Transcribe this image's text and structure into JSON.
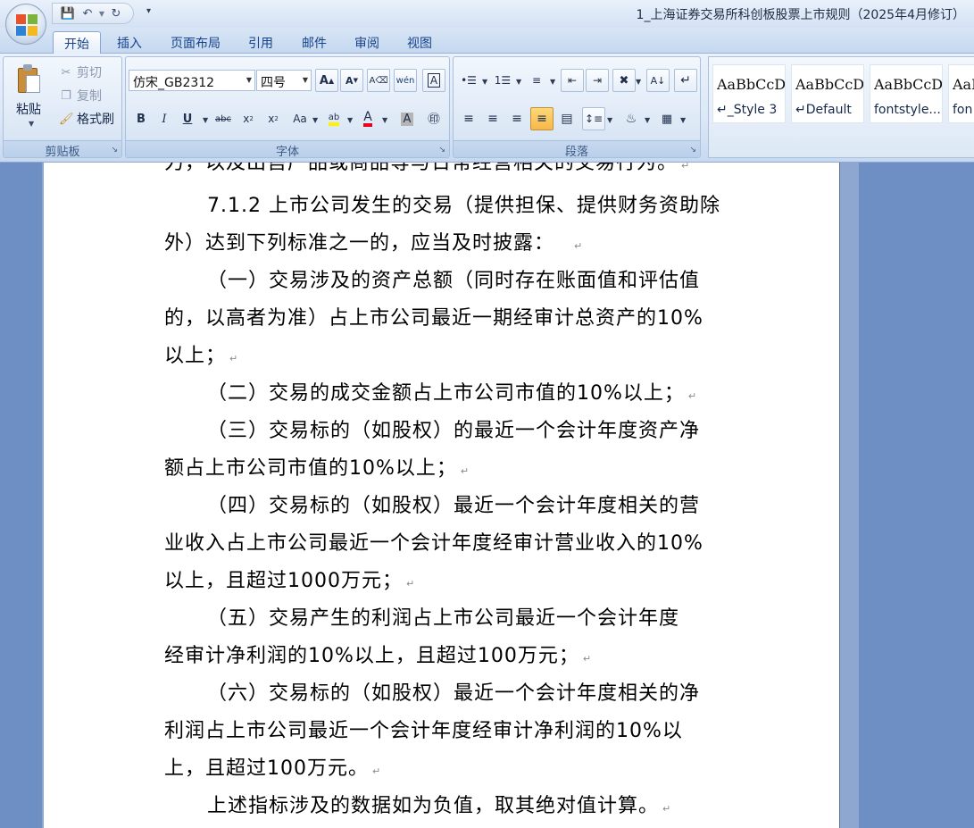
{
  "window": {
    "title": "1_上海证券交易所科创板股票上市规则（2025年4月修订）"
  },
  "tabs": [
    "开始",
    "插入",
    "页面布局",
    "引用",
    "邮件",
    "审阅",
    "视图"
  ],
  "clipboard": {
    "paste": "粘贴",
    "cut": "剪切",
    "copy": "复制",
    "format_painter": "格式刷",
    "group": "剪贴板"
  },
  "font": {
    "name": "仿宋_GB2312",
    "size": "四号",
    "group": "字体"
  },
  "paragraph": {
    "group": "段落"
  },
  "styles": [
    {
      "preview": "AaBbCcD",
      "name": "↵_Style 3"
    },
    {
      "preview": "AaBbCcDc",
      "name": "↵Default"
    },
    {
      "preview": "AaBbCcDc",
      "name": "fontstyle..."
    },
    {
      "preview": "AaB",
      "name": "fon"
    }
  ],
  "document": {
    "lines": [
      "力，以及出售产品或商品等与日常经营相关的交易行为。",
      "7.1.2 上市公司发生的交易（提供担保、提供财务资助除",
      "外）达到下列标准之一的，应当及时披露：",
      "（一）交易涉及的资产总额（同时存在账面值和评估值",
      "的，以高者为准）占上市公司最近一期经审计总资产的10%",
      "以上；",
      "（二）交易的成交金额占上市公司市值的10%以上；",
      "（三）交易标的（如股权）的最近一个会计年度资产净",
      "额占上市公司市值的10%以上；",
      "（四）交易标的（如股权）最近一个会计年度相关的营",
      "业收入占上市公司最近一个会计年度经审计营业收入的10%",
      "以上，且超过1000万元；",
      "（五）交易产生的利润占上市公司最近一个会计年度",
      "经审计净利润的10%以上，且超过100万元；",
      "（六）交易标的（如股权）最近一个会计年度相关的净",
      "利润占上市公司最近一个会计年度经审计净利润的10%以",
      "上，且超过100万元。",
      "上述指标涉及的数据如为负值，取其绝对值计算。"
    ],
    "para_mark": "↵"
  }
}
